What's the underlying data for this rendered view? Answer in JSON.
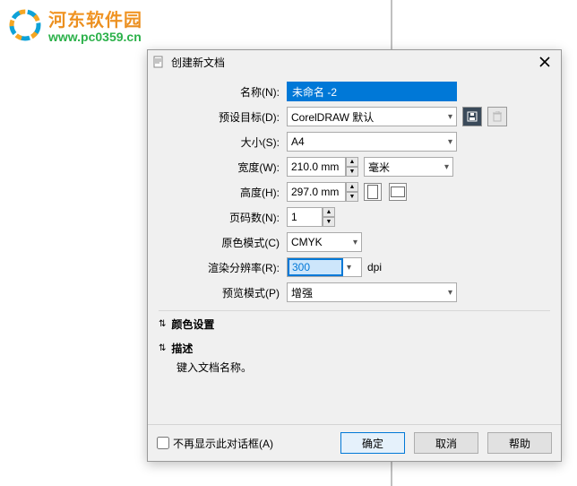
{
  "watermark": {
    "title": "河东软件园",
    "url": "www.pc0359.cn"
  },
  "dialog": {
    "title": "创建新文档",
    "fields": {
      "name": {
        "label": "名称(N):",
        "value": "未命名 -2"
      },
      "preset": {
        "label": "预设目标(D):",
        "value": "CorelDRAW 默认",
        "save_icon": "save-icon",
        "delete_icon": "delete-icon"
      },
      "size": {
        "label": "大小(S):",
        "value": "A4"
      },
      "width": {
        "label": "宽度(W):",
        "value": "210.0 mm",
        "unit": "毫米"
      },
      "height": {
        "label": "高度(H):",
        "value": "297.0 mm"
      },
      "pages": {
        "label": "页码数(N):",
        "value": "1"
      },
      "colormode": {
        "label": "原色模式(C)",
        "value": "CMYK"
      },
      "dpi": {
        "label": "渲染分辨率(R):",
        "value": "300",
        "unit": "dpi"
      },
      "preview": {
        "label": "预览模式(P)",
        "value": "增强"
      }
    },
    "sections": {
      "color": {
        "title": "颜色设置"
      },
      "desc": {
        "title": "描述",
        "text": "键入文档名称。"
      }
    },
    "footer": {
      "dontshow": "不再显示此对话框(A)",
      "ok": "确定",
      "cancel": "取消",
      "help": "帮助"
    }
  }
}
